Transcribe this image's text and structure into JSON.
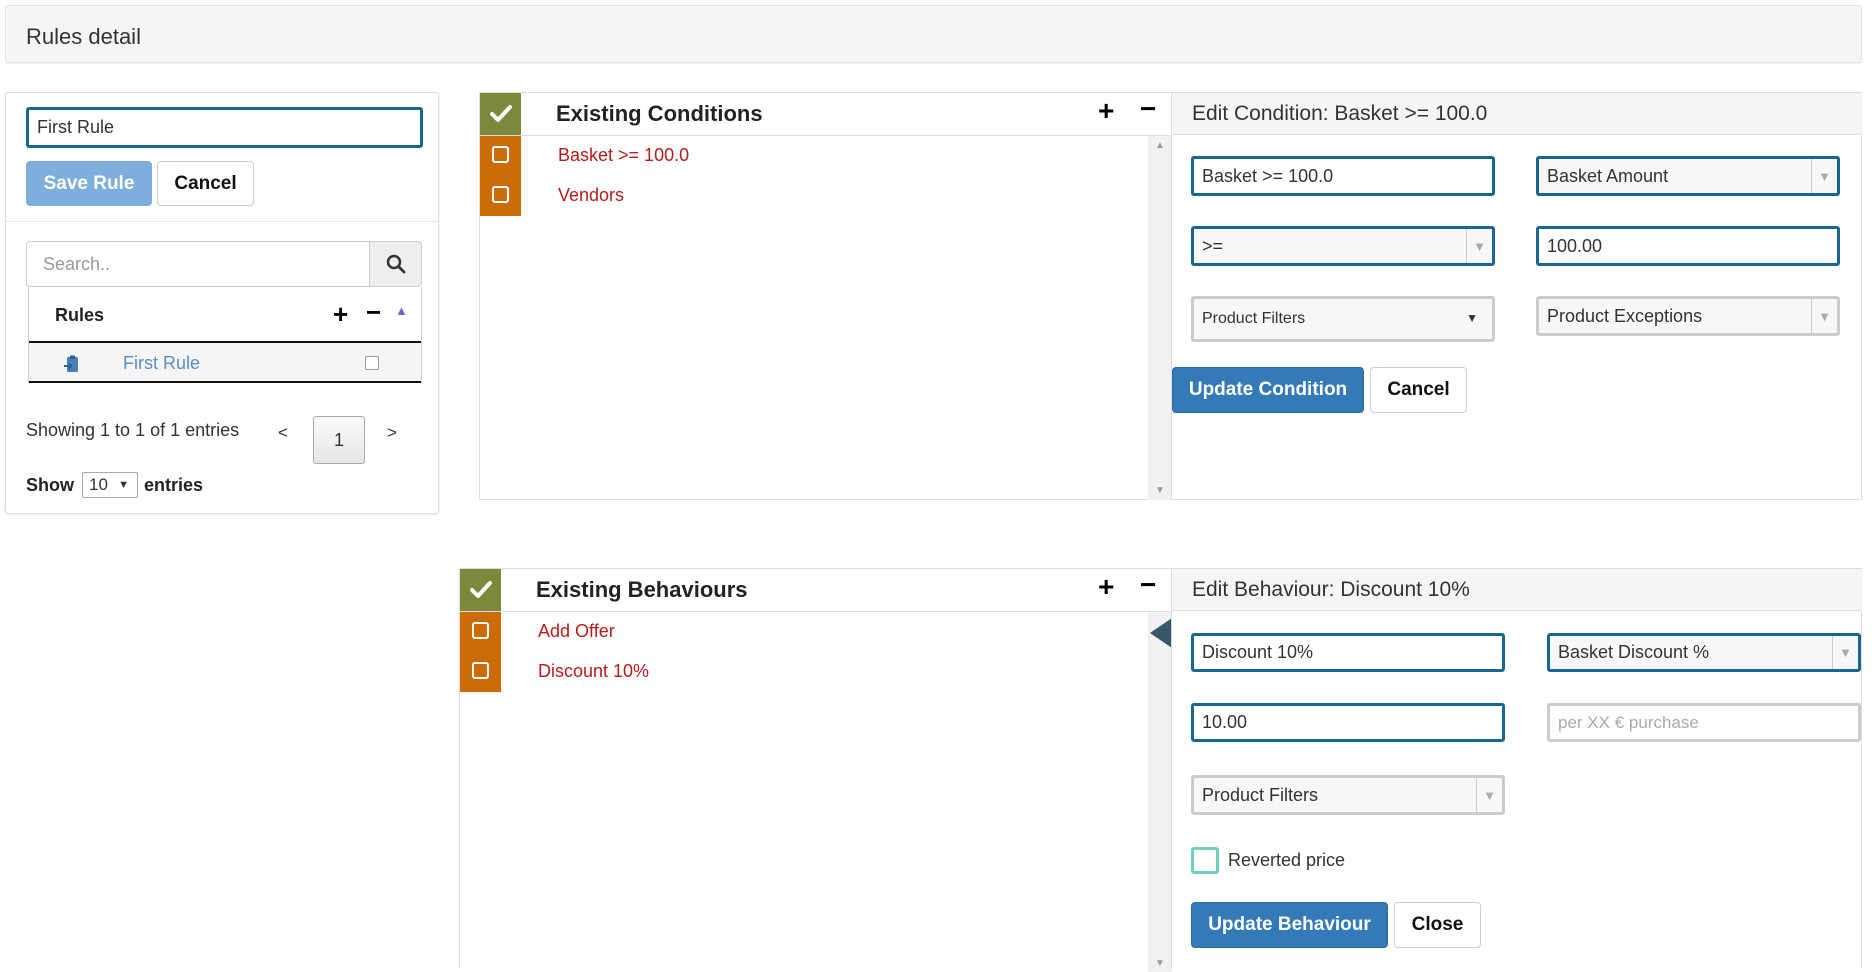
{
  "header": {
    "title": "Rules detail"
  },
  "left_panel": {
    "rule_name_value": "First Rule",
    "save_label": "Save Rule",
    "cancel_label": "Cancel",
    "search_placeholder": "Search..",
    "table": {
      "header": "Rules",
      "rows": [
        {
          "label": "First Rule"
        }
      ]
    },
    "pagination": {
      "info": "Showing 1 to 1 of 1 entries",
      "prev": "<",
      "page": "1",
      "next": ">"
    },
    "show_label": "Show",
    "show_value": "10",
    "entries_label": "entries"
  },
  "conditions": {
    "title": "Existing Conditions",
    "items": [
      {
        "label": "Basket >= 100.0"
      },
      {
        "label": "Vendors"
      }
    ],
    "edit": {
      "title": "Edit Condition: Basket >= 100.0",
      "name_value": "Basket >= 100.0",
      "type_value": "Basket Amount",
      "operator_value": ">=",
      "amount_value": "100.00",
      "filters_label": "Product Filters",
      "exceptions_label": "Product Exceptions",
      "update_label": "Update Condition",
      "cancel_label": "Cancel"
    }
  },
  "behaviours": {
    "title": "Existing Behaviours",
    "items": [
      {
        "label": "Add Offer"
      },
      {
        "label": "Discount 10%"
      }
    ],
    "edit": {
      "title": "Edit Behaviour: Discount 10%",
      "name_value": "Discount 10%",
      "type_value": "Basket Discount %",
      "amount_value": "10.00",
      "per_placeholder": "per XX € purchase",
      "filters_label": "Product Filters",
      "reverted_label": "Reverted price",
      "update_label": "Update Behaviour",
      "close_label": "Close"
    }
  },
  "colors": {
    "primary": "#337ab7",
    "olive": "#7a8a3a",
    "orange": "#cc6a05",
    "item_red": "#b71c1c",
    "input_border": "#1b6690"
  }
}
